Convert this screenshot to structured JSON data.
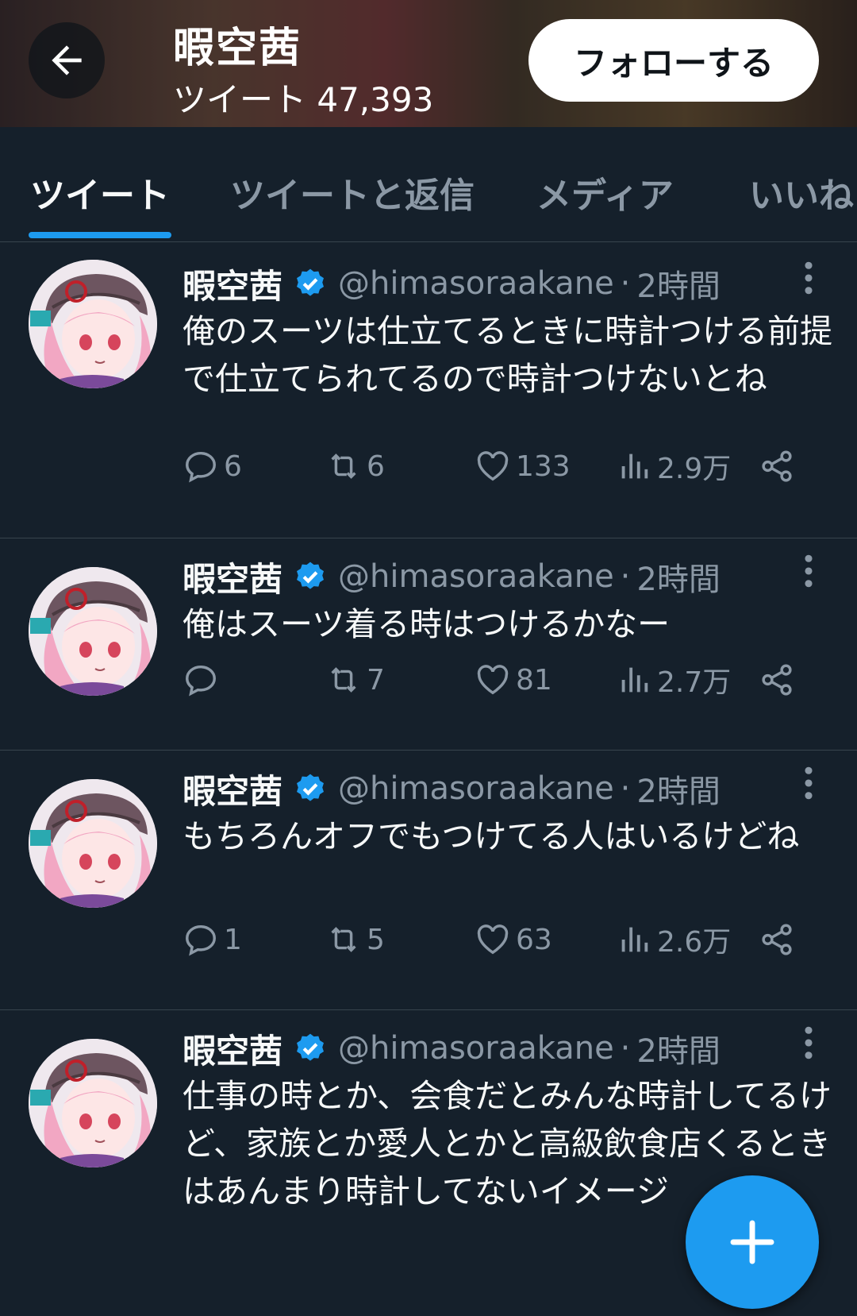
{
  "header": {
    "name": "暇空茜",
    "tweet_count_label": "ツイート 47,393",
    "follow_label": "フォローする"
  },
  "tabs": [
    "ツイート",
    "ツイートと返信",
    "メディア",
    "いいね"
  ],
  "colors": {
    "accent": "#1d9bf0",
    "background": "#15202b",
    "muted": "#8b98a5"
  },
  "tweets": [
    {
      "name": "暇空茜",
      "handle": "@himasoraakane",
      "sep": "·",
      "time": "2時間",
      "text": "俺のスーツは仕立てるときに時計つける前提で仕立てられてるので時計つけないとね",
      "replies": "6",
      "retweets": "6",
      "likes": "133",
      "views": "2.9万"
    },
    {
      "name": "暇空茜",
      "handle": "@himasoraakane",
      "sep": "·",
      "time": "2時間",
      "text": "俺はスーツ着る時はつけるかなー",
      "replies": "",
      "retweets": "7",
      "likes": "81",
      "views": "2.7万"
    },
    {
      "name": "暇空茜",
      "handle": "@himasoraakane",
      "sep": "·",
      "time": "2時間",
      "text": "もちろんオフでもつけてる人はいるけどね",
      "replies": "1",
      "retweets": "5",
      "likes": "63",
      "views": "2.6万"
    },
    {
      "name": "暇空茜",
      "handle": "@himasoraakane",
      "sep": "·",
      "time": "2時間",
      "text": "仕事の時とか、会食だとみんな時計してるけど、家族とか愛人とかと高級飲食店くるときはあんまり時計してないイメージ"
    }
  ],
  "fab": {
    "icon": "plus-icon"
  }
}
